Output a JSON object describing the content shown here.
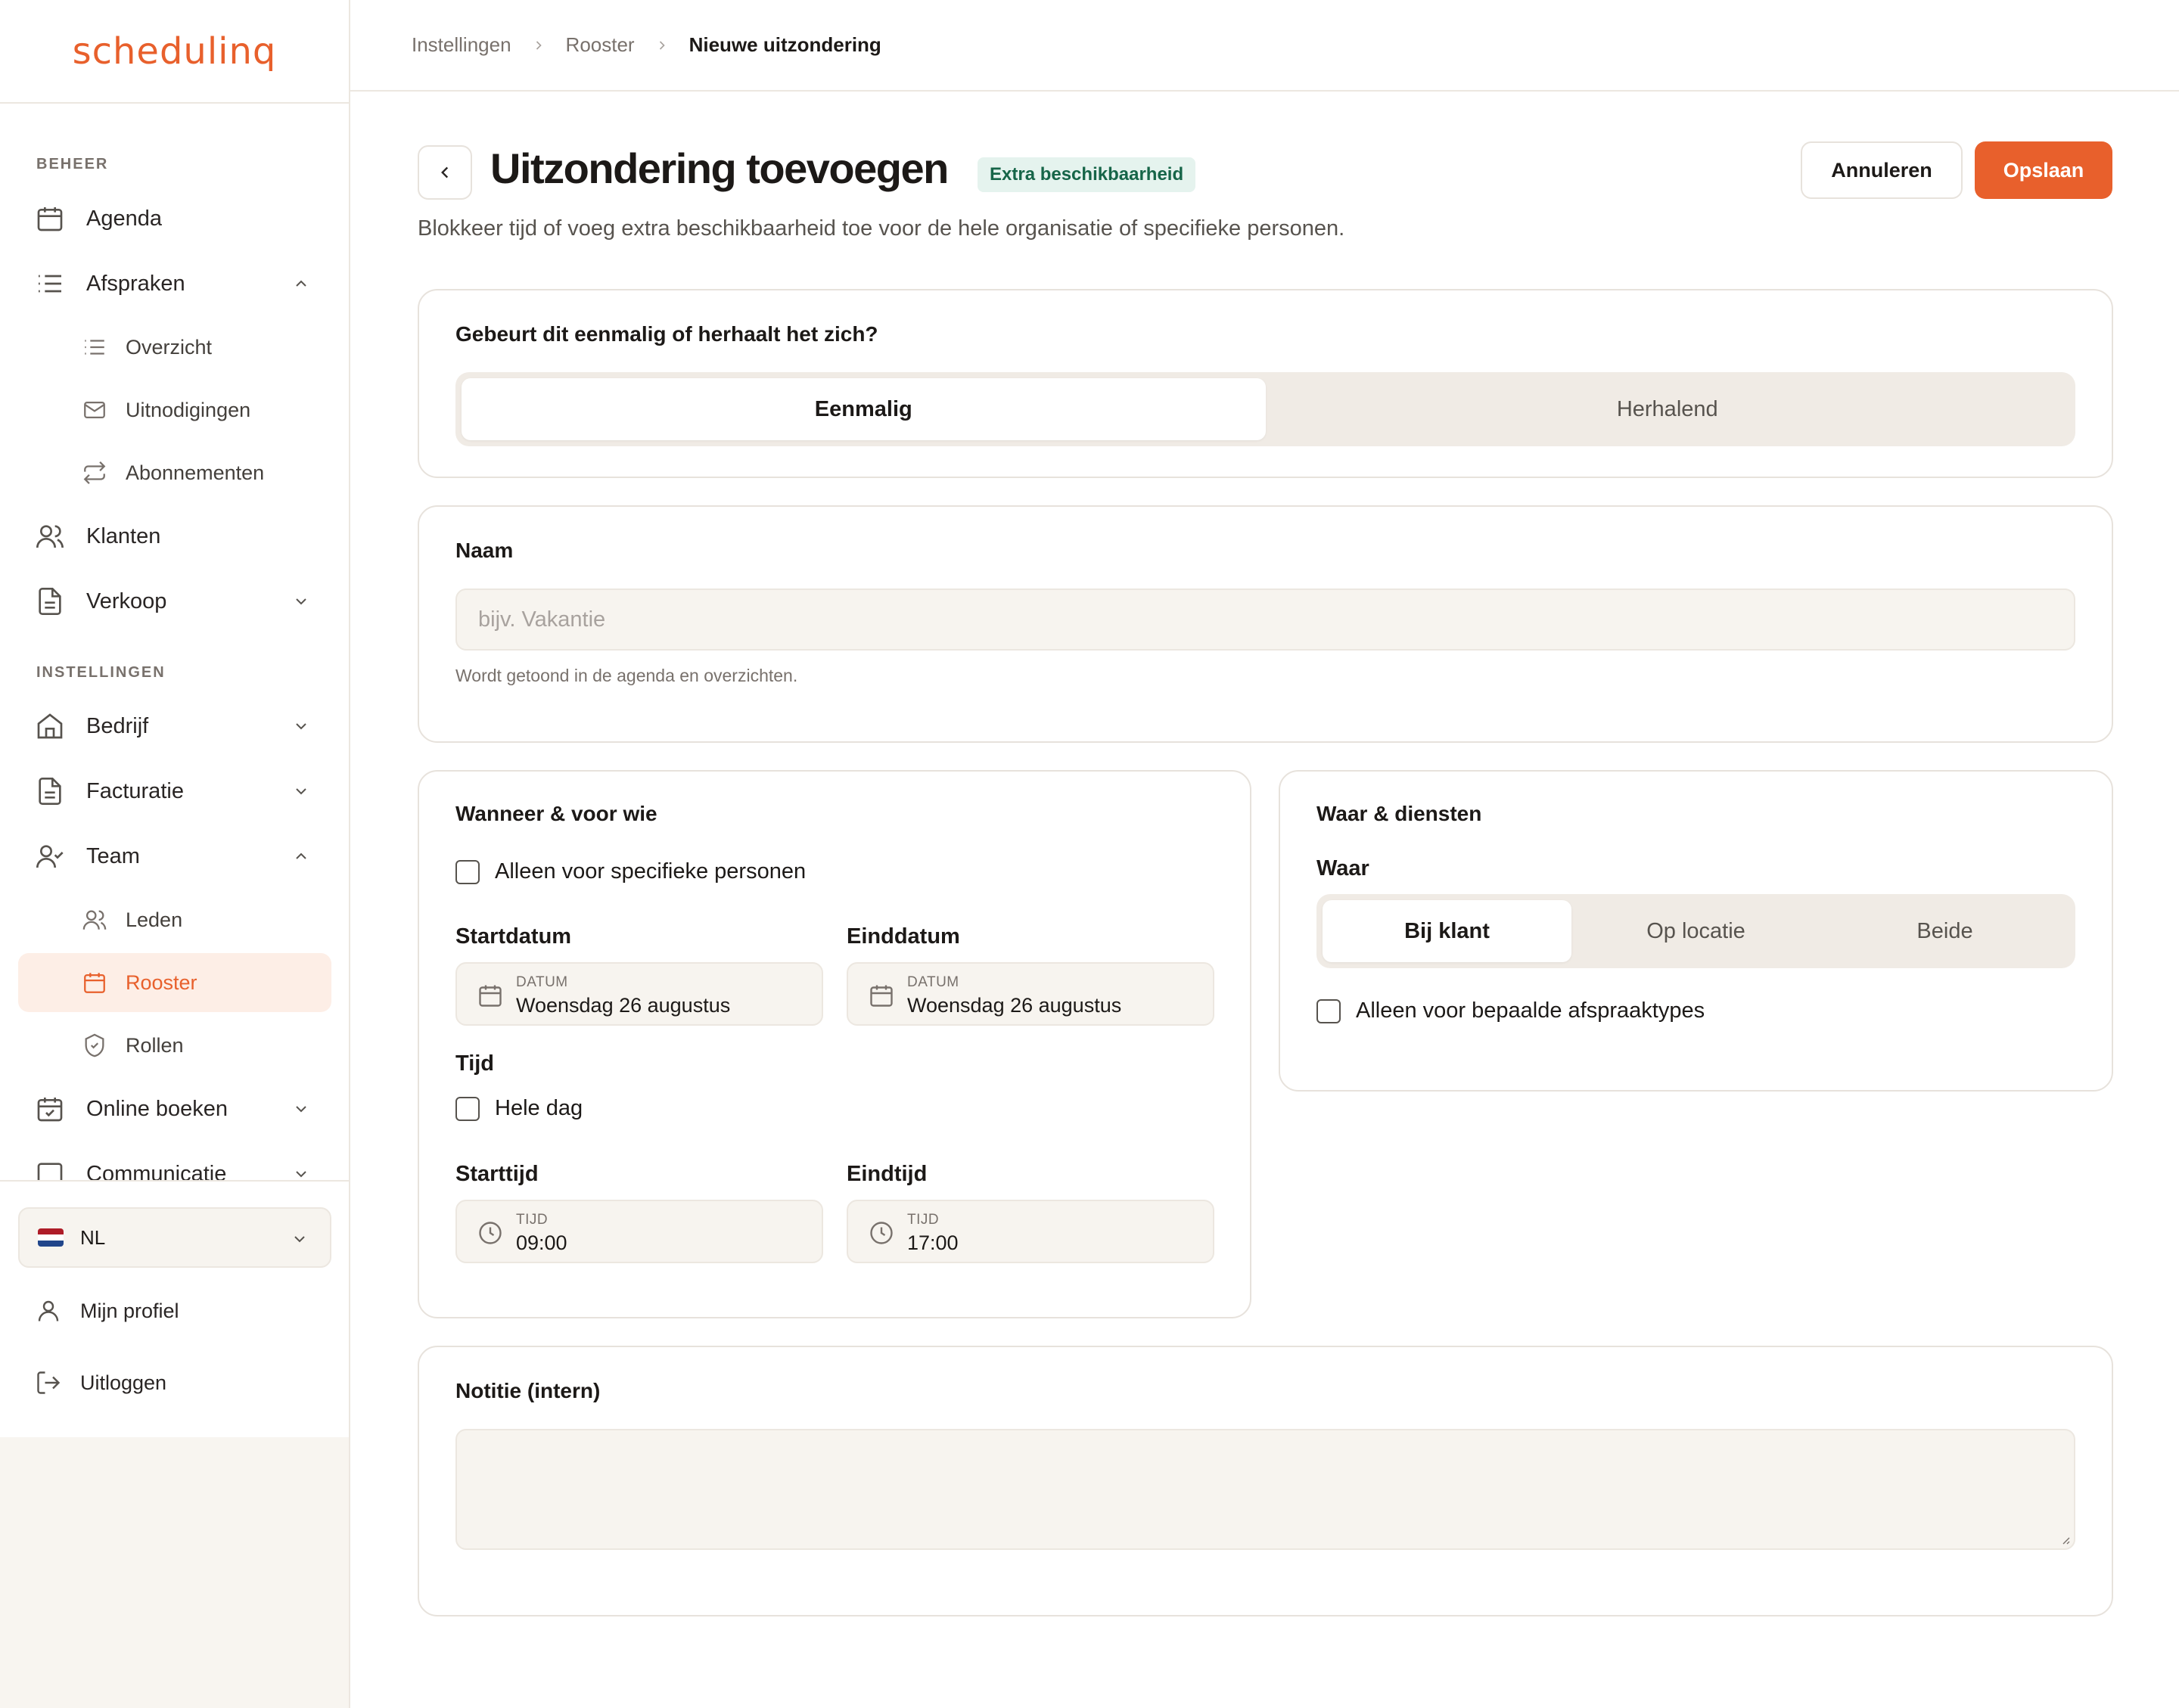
{
  "app": {
    "logo_text": "schedulinq",
    "brand_color": "#e8602c"
  },
  "sidebar": {
    "section_beheer": "BEHEER",
    "section_instellingen": "INSTELLINGEN",
    "items": {
      "agenda": "Agenda",
      "afspraken": "Afspraken",
      "overzicht": "Overzicht",
      "uitnodigingen": "Uitnodigingen",
      "abonnementen": "Abonnementen",
      "klanten": "Klanten",
      "verkoop": "Verkoop",
      "bedrijf": "Bedrijf",
      "facturatie": "Facturatie",
      "team": "Team",
      "leden": "Leden",
      "rooster": "Rooster",
      "rollen": "Rollen",
      "online_boeken": "Online boeken",
      "communicatie": "Communicatie"
    },
    "language": "NL",
    "profile": "Mijn profiel",
    "logout": "Uitloggen"
  },
  "breadcrumb": [
    "Instellingen",
    "Rooster",
    "Nieuwe uitzondering"
  ],
  "header": {
    "title": "Uitzondering toevoegen",
    "badge": "Extra beschikbaarheid",
    "subtitle": "Blokkeer tijd of voeg extra beschikbaarheid toe voor de hele organisatie of specifieke personen.",
    "cancel_label": "Annuleren",
    "save_label": "Opslaan"
  },
  "recurrence": {
    "question": "Gebeurt dit eenmalig of herhaalt het zich?",
    "options": [
      "Eenmalig",
      "Herhalend"
    ],
    "selected": "Eenmalig"
  },
  "name_card": {
    "label": "Naam",
    "placeholder": "bijv. Vakantie",
    "value": "",
    "helper": "Wordt getoond in de agenda en overzichten."
  },
  "when_card": {
    "title": "Wanneer & voor wie",
    "specific_persons_label": "Alleen voor specifieke personen",
    "specific_persons_checked": false,
    "start_date_label": "Startdatum",
    "end_date_label": "Einddatum",
    "date_caption": "DATUM",
    "start_date": "Woensdag 26 augustus",
    "end_date": "Woensdag 26 augustus",
    "time_label": "Tijd",
    "all_day_label": "Hele dag",
    "all_day_checked": false,
    "start_time_label": "Starttijd",
    "end_time_label": "Eindtijd",
    "time_caption": "TIJD",
    "start_time": "09:00",
    "end_time": "17:00"
  },
  "where_card": {
    "title": "Waar & diensten",
    "where_label": "Waar",
    "options": [
      "Bij klant",
      "Op locatie",
      "Beide"
    ],
    "selected": "Bij klant",
    "appointment_types_label": "Alleen voor bepaalde afspraaktypes",
    "appointment_types_checked": false
  },
  "note_card": {
    "title": "Notitie (intern)",
    "value": ""
  }
}
